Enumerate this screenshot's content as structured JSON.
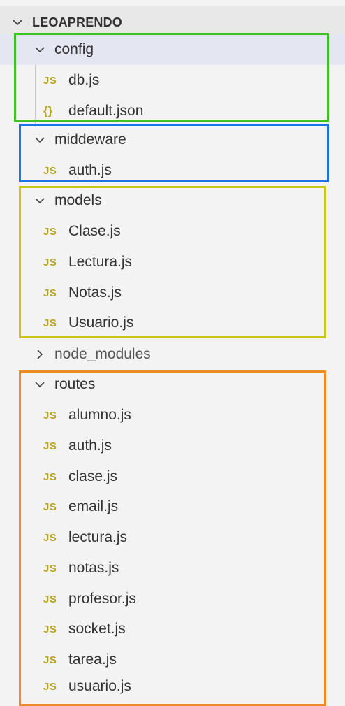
{
  "explorer": {
    "root": "LEOAPRENDO",
    "folders": {
      "config": {
        "label": "config",
        "files": [
          {
            "name": "db.js",
            "icon": "JS"
          },
          {
            "name": "default.json",
            "icon": "{}"
          }
        ]
      },
      "middeware": {
        "label": "middeware",
        "files": [
          {
            "name": "auth.js",
            "icon": "JS"
          }
        ]
      },
      "models": {
        "label": "models",
        "files": [
          {
            "name": "Clase.js",
            "icon": "JS"
          },
          {
            "name": "Lectura.js",
            "icon": "JS"
          },
          {
            "name": "Notas.js",
            "icon": "JS"
          },
          {
            "name": "Usuario.js",
            "icon": "JS"
          }
        ]
      },
      "node_modules": {
        "label": "node_modules"
      },
      "routes": {
        "label": "routes",
        "files": [
          {
            "name": "alumno.js",
            "icon": "JS"
          },
          {
            "name": "auth.js",
            "icon": "JS"
          },
          {
            "name": "clase.js",
            "icon": "JS"
          },
          {
            "name": "email.js",
            "icon": "JS"
          },
          {
            "name": "lectura.js",
            "icon": "JS"
          },
          {
            "name": "notas.js",
            "icon": "JS"
          },
          {
            "name": "profesor.js",
            "icon": "JS"
          },
          {
            "name": "socket.js",
            "icon": "JS"
          },
          {
            "name": "tarea.js",
            "icon": "JS"
          },
          {
            "name": "usuario.js",
            "icon": "JS"
          }
        ]
      }
    }
  },
  "annotation_colors": {
    "config": "#3cc21e",
    "middeware": "#1a73e8",
    "models": "#c8c41a",
    "routes": "#f08a24"
  }
}
